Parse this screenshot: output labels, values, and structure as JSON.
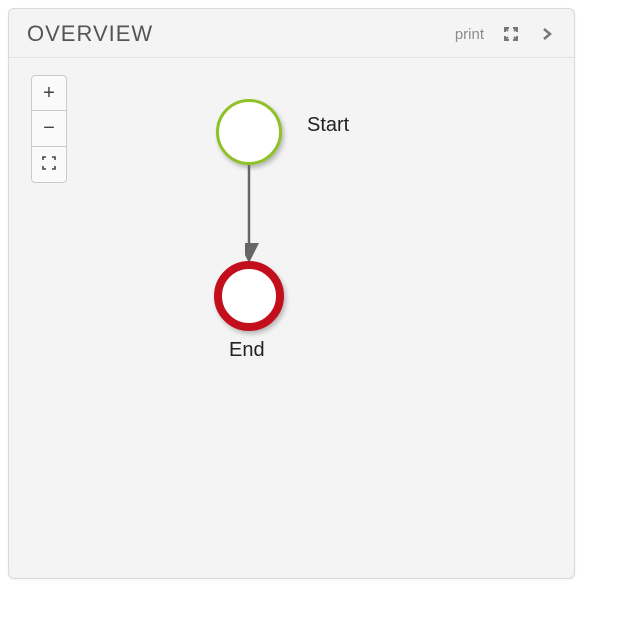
{
  "header": {
    "title": "OVERVIEW",
    "print_label": "print"
  },
  "nodes": {
    "start": {
      "label": "Start",
      "color": "#8fc226"
    },
    "end": {
      "label": "End",
      "color": "#c30e1b"
    }
  },
  "zoom": {
    "in_symbol": "+",
    "out_symbol": "−"
  }
}
